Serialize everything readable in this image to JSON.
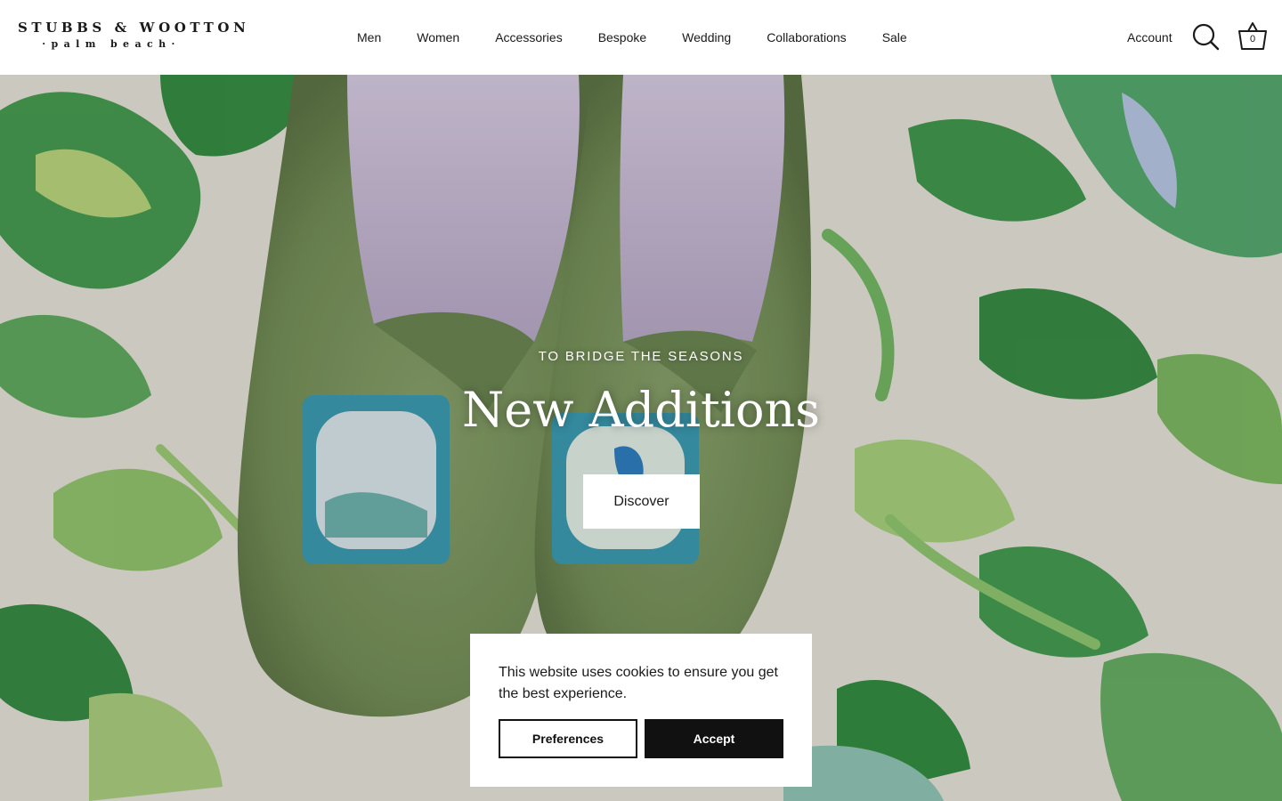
{
  "brand": {
    "name": "STUBBS & WOOTTON",
    "tagline": "·palm beach·"
  },
  "nav": {
    "items": [
      {
        "label": "Men"
      },
      {
        "label": "Women"
      },
      {
        "label": "Accessories"
      },
      {
        "label": "Bespoke"
      },
      {
        "label": "Wedding"
      },
      {
        "label": "Collaborations"
      },
      {
        "label": "Sale"
      }
    ]
  },
  "header": {
    "account_label": "Account",
    "search_icon": "search-icon",
    "cart_icon": "basket-icon",
    "cart_count": "0"
  },
  "hero": {
    "eyebrow": "TO BRIDGE THE SEASONS",
    "title": "New Additions",
    "cta_label": "Discover",
    "image_description_colors": {
      "velvet": "#7d9660",
      "fabric": "#e6e2d7",
      "leaf": "#2f8a3e"
    }
  },
  "cookie": {
    "message": "This website uses cookies to ensure you get the best experience.",
    "preferences_label": "Preferences",
    "accept_label": "Accept"
  }
}
